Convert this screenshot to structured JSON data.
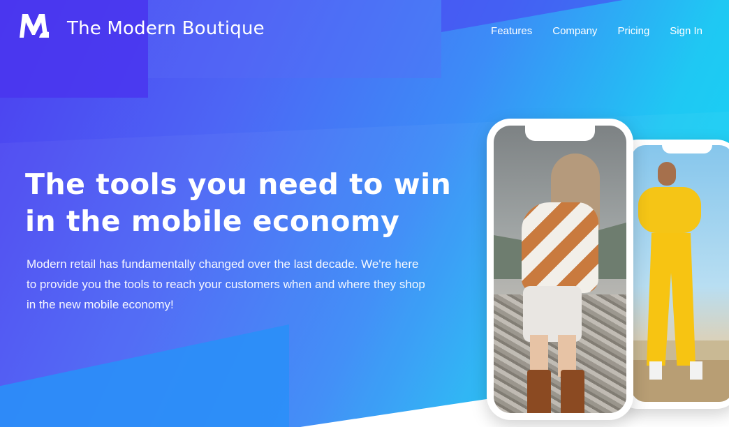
{
  "brand": {
    "name": "The Modern Boutique",
    "logo_icon": "boutique-m-logo-icon"
  },
  "nav": {
    "items": [
      {
        "label": "Features"
      },
      {
        "label": "Company"
      },
      {
        "label": "Pricing"
      },
      {
        "label": "Sign In"
      }
    ]
  },
  "hero": {
    "headline_line1": "The tools you need to win",
    "headline_line2": "in the mobile economy",
    "lead": "Modern retail has fundamentally changed over the last decade. We're here to provide you the tools to reach your customers when and where they shop in the new mobile economy!"
  },
  "colors": {
    "gradient_start": "#4c3ff0",
    "gradient_mid": "#3c8cf7",
    "gradient_end": "#12d8f5",
    "text": "#ffffff"
  },
  "mockups": {
    "front_phone_image": "woman-in-striped-sweater-on-beach",
    "back_phone_image": "woman-in-yellow-tracksuit"
  }
}
